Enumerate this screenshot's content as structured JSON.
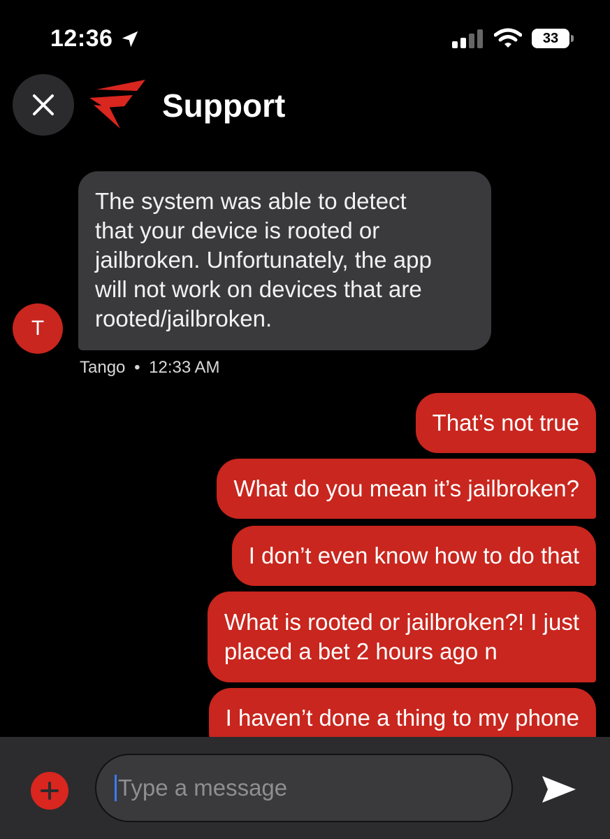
{
  "status_bar": {
    "time": "12:36",
    "battery": "33",
    "icons": [
      "location-arrow-icon",
      "signal-icon",
      "wifi-icon",
      "battery-icon"
    ]
  },
  "header": {
    "title": "Support",
    "logo": "fanatics-logo",
    "close_icon": "close-icon"
  },
  "messages": {
    "incoming": {
      "avatar_letter": "T",
      "lines": [
        "The system was able to detect",
        "that your device is rooted or",
        "jailbroken. Unfortunately, the app",
        "will not work on devices that are",
        "rooted/jailbroken."
      ],
      "sender": "Tango",
      "separator": "•",
      "time": "12:33 AM"
    },
    "outgoing": [
      "That’s not true",
      "What do you mean it’s jailbroken?",
      "I don’t even know how to do that",
      "What is rooted or jailbroken?! I just",
      "placed a bet 2 hours ago n",
      "I haven’t done a thing to my phone"
    ]
  },
  "composer": {
    "placeholder": "Type a message",
    "add_icon": "plus-icon",
    "send_icon": "send-icon"
  },
  "colors": {
    "accent_red": "#c8261e",
    "incoming_bubble": "#3a3a3c",
    "composer_bg": "#2c2c2e"
  }
}
